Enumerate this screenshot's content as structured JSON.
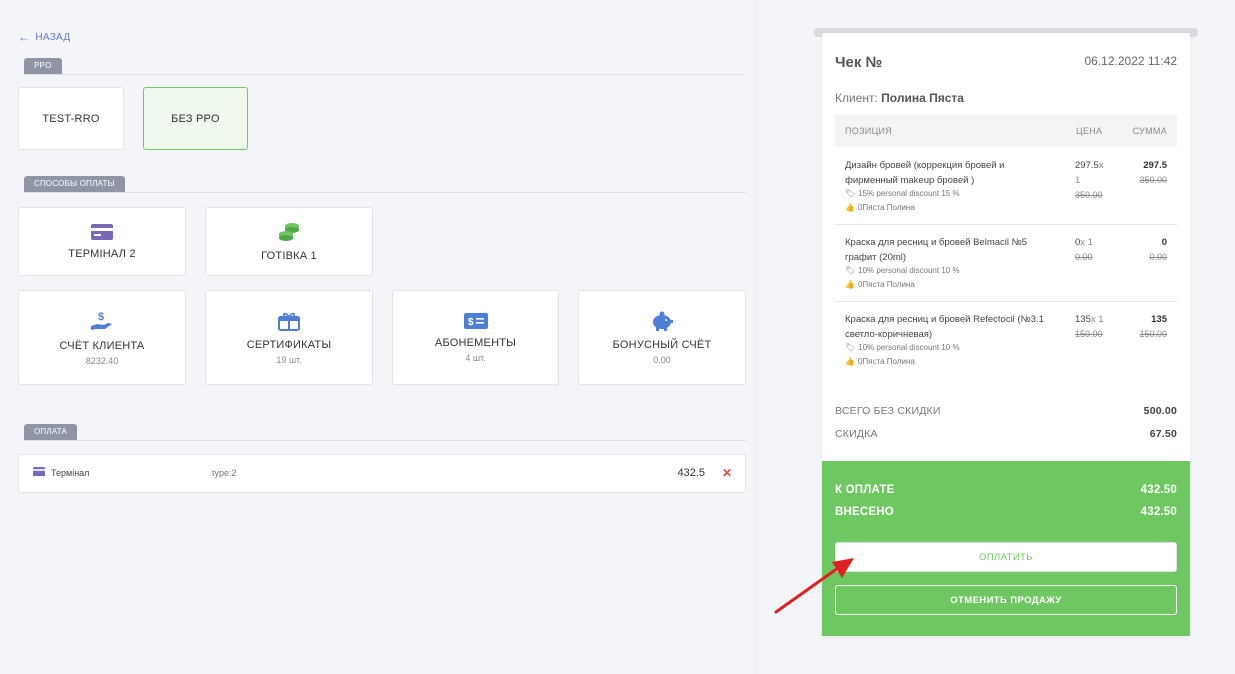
{
  "nav": {
    "back_label": "НАЗАД"
  },
  "rro": {
    "section_label": "PPO",
    "options": [
      {
        "label": "TEST-RRO",
        "selected": false
      },
      {
        "label": "БЕЗ PPO",
        "selected": true
      }
    ]
  },
  "payment_methods": {
    "section_label": "СПОСОБЫ ОПЛАТЫ",
    "cards": [
      {
        "label": "ТЕРМІНАЛ 2",
        "sub": "",
        "icon": "credit-card-icon"
      },
      {
        "label": "ГОТІВКА 1",
        "sub": "",
        "icon": "coins-icon"
      },
      {
        "label": "СЧЁТ КЛИЕНТА",
        "sub": "8232.40",
        "icon": "hand-dollar-icon"
      },
      {
        "label": "СЕРТИФИКАТЫ",
        "sub": "19 шт.",
        "icon": "gift-icon"
      },
      {
        "label": "АБОНЕМЕНТЫ",
        "sub": "4 шт.",
        "icon": "cash-ticket-icon"
      },
      {
        "label": "БОНУСНЫЙ СЧЁТ",
        "sub": "0.00",
        "icon": "piggy-bank-icon"
      }
    ]
  },
  "payment": {
    "section_label": "ОПЛАТА",
    "rows": [
      {
        "name": "Термінал",
        "type": "type:2",
        "amount": "432.5"
      }
    ],
    "delete_glyph": "✕"
  },
  "receipt": {
    "title": "Чек №",
    "date": "06.12.2022 11:42",
    "client_label": "Клиент:",
    "client_name": "Полина Пяста",
    "columns": {
      "position": "ПОЗИЦИЯ",
      "price": "ЦЕНА",
      "sum": "СУММА"
    },
    "items": [
      {
        "name": "Дизайн бровей (коррекция бровей и фирменный makeup бровей )",
        "discount": "15% personal discount 15 %",
        "master": "0Пяста Полина",
        "price": "297.5",
        "qty": "1",
        "old_price": "350.00",
        "sum": "297.5",
        "old_sum": "350.00"
      },
      {
        "name": "Краска для ресниц и бровей Belmacil №5 графит (20ml)",
        "discount": "10% personal discount 10 %",
        "master": "0Пяста Полина",
        "price": "0",
        "qty": "1",
        "old_price": "0.00",
        "sum": "0",
        "old_sum": "0.00"
      },
      {
        "name": "Краска для ресниц и бровей Refectocil (№3.1 светло-коричневая)",
        "discount": "10% personal discount 10 %",
        "master": "0Пяста Полина",
        "price": "135",
        "qty": "1",
        "old_price": "150.00",
        "sum": "135",
        "old_sum": "150.00"
      }
    ],
    "totals": {
      "no_discount_label": "ВСЕГО БЕЗ СКИДКИ",
      "no_discount_value": "500.00",
      "discount_label": "СКИДКА",
      "discount_value": "67.50"
    },
    "pay": {
      "due_label": "К ОПЛАТЕ",
      "due_value": "432.50",
      "paid_label": "ВНЕСЕНО",
      "paid_value": "432.50",
      "pay_button": "ОПЛАТИТЬ",
      "cancel_button": "ОТМЕНИТЬ ПРОДАЖУ"
    }
  },
  "colors": {
    "accent_green": "#6fc762",
    "link_blue": "#5b7fc7",
    "delete_red": "#e04848",
    "arrow_red": "#e02020"
  }
}
